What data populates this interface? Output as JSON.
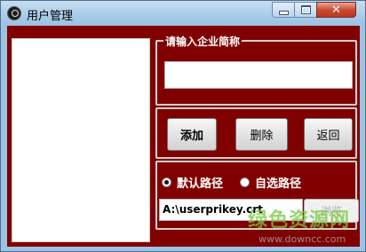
{
  "window": {
    "title": "用户管理"
  },
  "icons": {
    "app": "app-icon",
    "minimize": "minimize-icon",
    "maximize": "maximize-icon",
    "close": "close-icon"
  },
  "name_group": {
    "legend": "请输入企业简称",
    "value": ""
  },
  "buttons": {
    "add": "添加",
    "delete": "删除",
    "back": "返回"
  },
  "path_group": {
    "radio_default": "默认路径",
    "radio_custom": "自选路径",
    "selected": "默认路径",
    "path_value": "A:\\userprikey.crt",
    "browse": "浏览"
  },
  "watermark": {
    "text": "绿色资源网",
    "url": "www.downcc.com"
  },
  "colors": {
    "client_bg": "#800000",
    "titlebar": "#a9cbe8",
    "close_button": "#c9462f"
  }
}
